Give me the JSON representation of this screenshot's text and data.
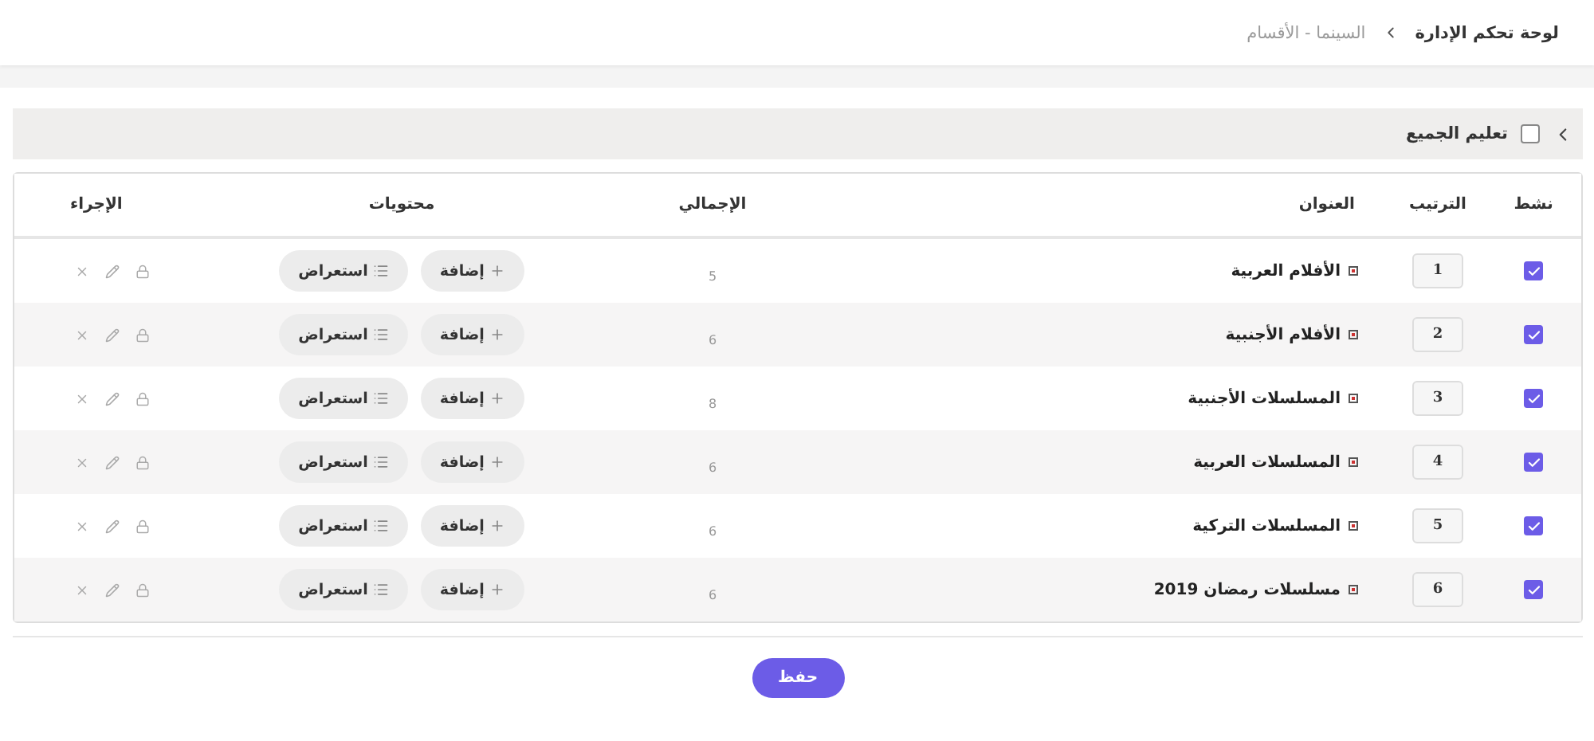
{
  "breadcrumb": [
    {
      "label": "لوحة تحكم الإدارة",
      "current": false
    },
    {
      "label": "السينما - الأقسام",
      "current": true
    }
  ],
  "select_all": {
    "label": "تعليم الجميع",
    "checked": false
  },
  "columns": [
    "نشط",
    "الترتيب",
    "العنوان",
    "الإجمالي",
    "محتويات",
    "الإجراء"
  ],
  "rows": [
    {
      "active": true,
      "order": "1",
      "title": "الأفلام العربية",
      "total": "5",
      "add": "إضافة",
      "view": "استعراض"
    },
    {
      "active": true,
      "order": "2",
      "title": "الأفلام الأجنبية",
      "total": "6",
      "add": "إضافة",
      "view": "استعراض"
    },
    {
      "active": true,
      "order": "3",
      "title": "المسلسلات الأجنبية",
      "total": "8",
      "add": "إضافة",
      "view": "استعراض"
    },
    {
      "active": true,
      "order": "4",
      "title": "المسلسلات العربية",
      "total": "6",
      "add": "إضافة",
      "view": "استعراض"
    },
    {
      "active": true,
      "order": "5",
      "title": "المسلسلات التركية",
      "total": "6",
      "add": "إضافة",
      "view": "استعراض"
    },
    {
      "active": true,
      "order": "6",
      "title": "مسلسلات رمضان 2019",
      "total": "6",
      "add": "إضافة",
      "view": "استعراض"
    }
  ],
  "save_button": "حفظ"
}
